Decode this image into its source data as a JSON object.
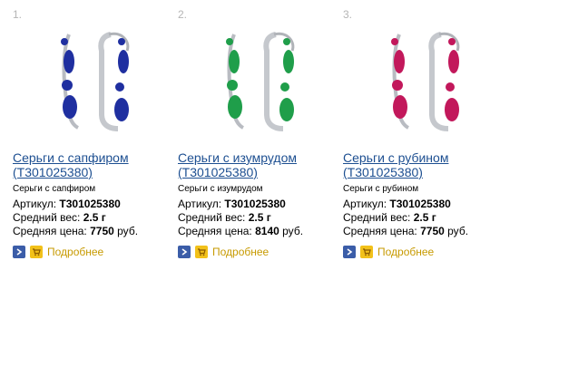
{
  "products": [
    {
      "index": "1.",
      "title": "Серьги с сапфиром (Т301025380)",
      "description": "Серьги с сапфиром",
      "article_label": "Артикул:",
      "article": "Т301025380",
      "weight_label": "Средний вес:",
      "weight": "2.5 г",
      "price_label": "Средняя цена:",
      "price": "7750",
      "currency": "руб.",
      "more_label": "Подробнее",
      "stone_color": "#1f2fa0"
    },
    {
      "index": "2.",
      "title": "Серьги с изумрудом (Т301025380)",
      "description": "Серьги с изумрудом",
      "article_label": "Артикул:",
      "article": "Т301025380",
      "weight_label": "Средний вес:",
      "weight": "2.5 г",
      "price_label": "Средняя цена:",
      "price": "8140",
      "currency": "руб.",
      "more_label": "Подробнее",
      "stone_color": "#1f9e4a"
    },
    {
      "index": "3.",
      "title": "Серьги с рубином (Т301025380)",
      "description": "Серьги с рубином",
      "article_label": "Артикул:",
      "article": "Т301025380",
      "weight_label": "Средний вес:",
      "weight": "2.5 г",
      "price_label": "Средняя цена:",
      "price": "7750",
      "currency": "руб.",
      "more_label": "Подробнее",
      "stone_color": "#c2185b"
    }
  ],
  "colors": {
    "link": "#1d4f91",
    "more_link": "#c79a00",
    "index_gray": "#b5b5b5",
    "go_button": "#3b5da8",
    "cart_button": "#f2c11a"
  }
}
